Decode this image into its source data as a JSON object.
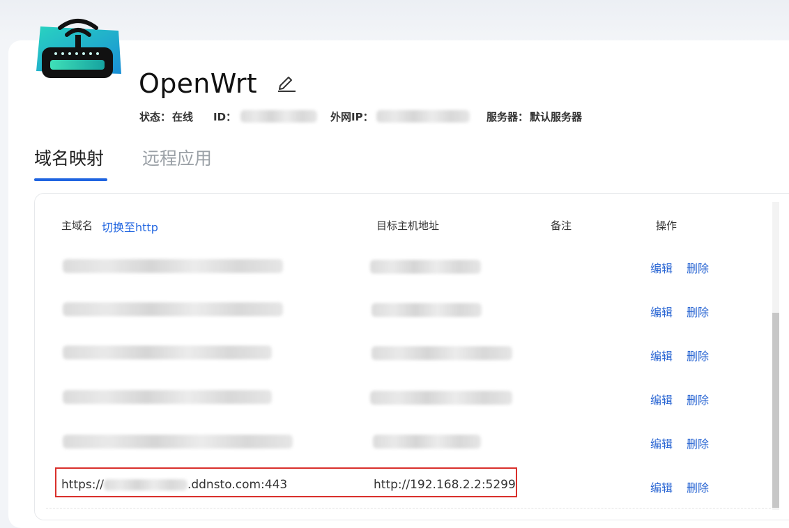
{
  "device": {
    "name": "OpenWrt",
    "status_label": "状态：",
    "status_value": "在线",
    "id_label": "ID：",
    "ip_label": "外网IP：",
    "server_label": "服务器：",
    "server_value": "默认服务器"
  },
  "tabs": [
    {
      "label": "域名映射",
      "active": true
    },
    {
      "label": "远程应用",
      "active": false
    }
  ],
  "table": {
    "headers": {
      "domain": "主域名",
      "switch_link": "切换至http",
      "target": "目标主机地址",
      "note": "备注",
      "action": "操作"
    },
    "actions": {
      "edit": "编辑",
      "delete": "删除"
    },
    "last_row": {
      "domain_prefix": "https://",
      "domain_suffix": ".ddnsto.com:443",
      "target": "http://192.168.2.2:5299"
    }
  },
  "colors": {
    "accent": "#1f64e0",
    "link": "#2a66d3",
    "highlight": "#d9302b"
  },
  "icons": {
    "logo": "router-icon",
    "edit": "pencil-icon"
  }
}
